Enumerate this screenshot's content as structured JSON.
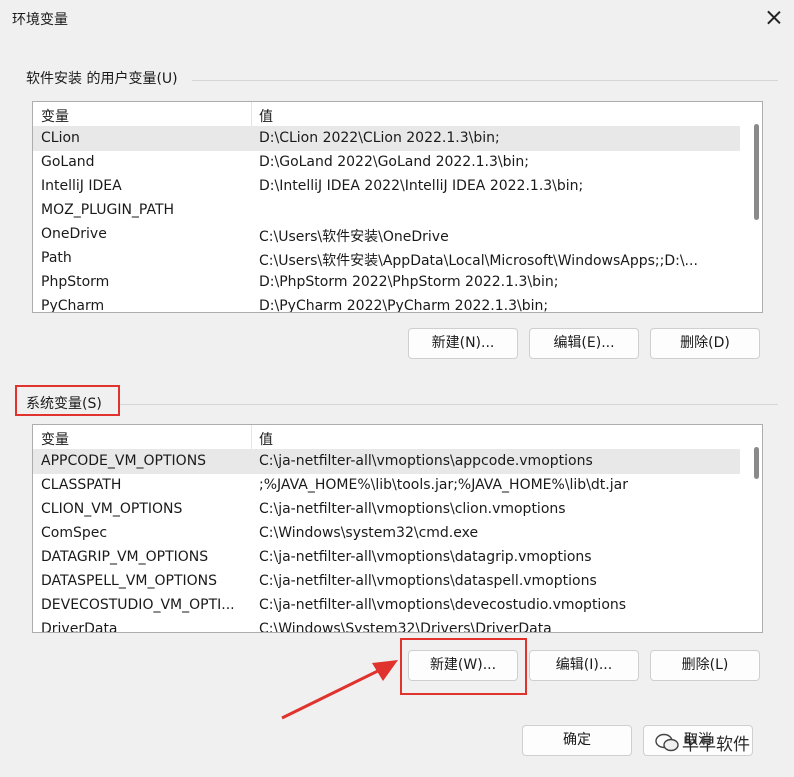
{
  "window": {
    "title": "环境变量"
  },
  "user_group": {
    "label": "软件安装 的用户变量(U)",
    "headers": {
      "variable": "变量",
      "value": "值"
    },
    "rows": [
      {
        "name": "CLion",
        "value": "D:\\CLion 2022\\CLion 2022.1.3\\bin;"
      },
      {
        "name": "GoLand",
        "value": "D:\\GoLand 2022\\GoLand 2022.1.3\\bin;"
      },
      {
        "name": "IntelliJ IDEA",
        "value": "D:\\IntelliJ IDEA 2022\\IntelliJ IDEA 2022.1.3\\bin;"
      },
      {
        "name": "MOZ_PLUGIN_PATH",
        "value": ""
      },
      {
        "name": "OneDrive",
        "value": "C:\\Users\\软件安装\\OneDrive"
      },
      {
        "name": "Path",
        "value": "C:\\Users\\软件安装\\AppData\\Local\\Microsoft\\WindowsApps;;D:\\..."
      },
      {
        "name": "PhpStorm",
        "value": "D:\\PhpStorm 2022\\PhpStorm 2022.1.3\\bin;"
      },
      {
        "name": "PyCharm",
        "value": "D:\\PyCharm 2022\\PyCharm 2022.1.3\\bin;"
      }
    ],
    "buttons": {
      "new": "新建(N)...",
      "edit": "编辑(E)...",
      "delete": "删除(D)"
    }
  },
  "system_group": {
    "label": "系统变量(S)",
    "headers": {
      "variable": "变量",
      "value": "值"
    },
    "rows": [
      {
        "name": "APPCODE_VM_OPTIONS",
        "value": "C:\\ja-netfilter-all\\vmoptions\\appcode.vmoptions"
      },
      {
        "name": "CLASSPATH",
        "value": ";%JAVA_HOME%\\lib\\tools.jar;%JAVA_HOME%\\lib\\dt.jar"
      },
      {
        "name": "CLION_VM_OPTIONS",
        "value": "C:\\ja-netfilter-all\\vmoptions\\clion.vmoptions"
      },
      {
        "name": "ComSpec",
        "value": "C:\\Windows\\system32\\cmd.exe"
      },
      {
        "name": "DATAGRIP_VM_OPTIONS",
        "value": "C:\\ja-netfilter-all\\vmoptions\\datagrip.vmoptions"
      },
      {
        "name": "DATASPELL_VM_OPTIONS",
        "value": "C:\\ja-netfilter-all\\vmoptions\\dataspell.vmoptions"
      },
      {
        "name": "DEVECOSTUDIO_VM_OPTI...",
        "value": "C:\\ja-netfilter-all\\vmoptions\\devecostudio.vmoptions"
      },
      {
        "name": "DriverData",
        "value": "C:\\Windows\\System32\\Drivers\\DriverData"
      }
    ],
    "buttons": {
      "new": "新建(W)...",
      "edit": "编辑(I)...",
      "delete": "删除(L)"
    }
  },
  "footer": {
    "ok": "确定",
    "cancel": "取消"
  },
  "watermark": {
    "text": "早早软件"
  },
  "colors": {
    "highlight": "#e0332e",
    "background": "#f0f0f0"
  }
}
